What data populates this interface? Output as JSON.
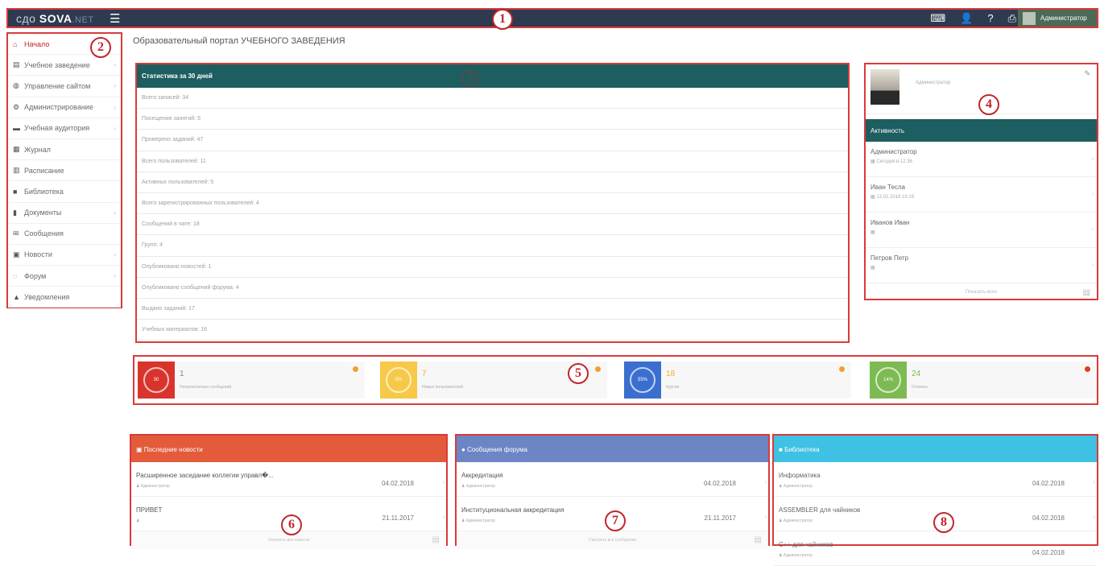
{
  "topbar": {
    "logo_prefix": "сдо",
    "logo_main": "SOVA",
    "logo_suffix": ".NET",
    "menu_icon": "hamburger-icon",
    "icons": [
      "keyboard-icon",
      "user-icon",
      "help-icon",
      "print-icon"
    ],
    "user_name": "Администратор"
  },
  "markers": [
    "1",
    "2",
    "3",
    "4",
    "5",
    "6",
    "7",
    "8"
  ],
  "sidebar": {
    "items": [
      {
        "icon": "home-icon",
        "label": "Начало",
        "active": true,
        "chevron": false
      },
      {
        "icon": "institution-icon",
        "label": "Учебное заведение",
        "active": false,
        "chevron": true
      },
      {
        "icon": "globe-icon",
        "label": "Управление сайтом",
        "active": false,
        "chevron": true
      },
      {
        "icon": "gear-icon",
        "label": "Администрирование",
        "active": false,
        "chevron": true
      },
      {
        "icon": "classroom-icon",
        "label": "Учебная аудитория",
        "active": false,
        "chevron": true
      },
      {
        "icon": "table-icon",
        "label": "Журнал",
        "active": false,
        "chevron": false
      },
      {
        "icon": "schedule-icon",
        "label": "Расписание",
        "active": false,
        "chevron": false
      },
      {
        "icon": "book-icon",
        "label": "Библиотека",
        "active": false,
        "chevron": false
      },
      {
        "icon": "document-icon",
        "label": "Документы",
        "active": false,
        "chevron": true
      },
      {
        "icon": "envelope-icon",
        "label": "Сообщения",
        "active": false,
        "chevron": false
      },
      {
        "icon": "news-icon",
        "label": "Новости",
        "active": false,
        "chevron": true
      },
      {
        "icon": "forum-icon",
        "label": "Форум",
        "active": false,
        "chevron": true
      },
      {
        "icon": "alert-icon",
        "label": "Уведомления",
        "active": false,
        "chevron": false
      }
    ]
  },
  "page_title": "Образовательный портал УЧЕБНОГО ЗАВЕДЕНИЯ",
  "stats_panel": {
    "title": "Статистика за 30 дней",
    "rows": [
      "Всего записей: 34",
      "Посещения занятий: 5",
      "Проверено заданий: 47",
      "Всего пользователей: 11",
      "Активных пользователей: 5",
      "Всего зарегистрированных пользователей: 4",
      "Сообщений в чате: 18",
      "Групп: 4",
      "Опубликовано новостей: 1",
      "Опубликовано сообщений форума: 4",
      "Выдано заданий: 17",
      "Учебных материалов: 16"
    ]
  },
  "profile": {
    "photo_icon": "user-photo",
    "name": "Администратор",
    "edit_icon": "edit-icon",
    "activity_title": "Активность",
    "activity": [
      {
        "name": "Администратор",
        "date": "Сегодня в 12:36"
      },
      {
        "name": "Иван Тесла",
        "date": "13.02.2018 10:19"
      },
      {
        "name": "Иванов Иван",
        "date": ""
      },
      {
        "name": "Петров Петр",
        "date": ""
      }
    ],
    "more_label": "Показать всех",
    "calendar_icon": "calendar-icon"
  },
  "info_boxes": [
    {
      "ring": "30",
      "number": "1",
      "label": "Непрочитанных сообщений",
      "color": "#d9342c",
      "num_color": "#888",
      "dot": "#f0a030"
    },
    {
      "ring": "0%",
      "number": "7",
      "label": "Новых пользователей",
      "color": "#f7c948",
      "num_color": "#f0b030",
      "dot": "#f0a030"
    },
    {
      "ring": "55%",
      "number": "18",
      "label": "Курсов",
      "color": "#3a6fd0",
      "num_color": "#f0b030",
      "dot": "#f0a030"
    },
    {
      "ring": "14%",
      "number": "24",
      "label": "Отлично",
      "color": "#7dbb52",
      "num_color": "#7dbb52",
      "dot": "#d94020"
    }
  ],
  "widgets": {
    "news": {
      "title": "Последние новости",
      "icon": "news-icon",
      "color": "#e35b3b",
      "items": [
        {
          "title": "Расширенное заседание коллегии управл�...",
          "author": "Администратор",
          "date": "04.02.2018"
        },
        {
          "title": "ПРИВЕТ",
          "author": "",
          "date": "21.11.2017"
        }
      ],
      "footer": "Смотреть все новости"
    },
    "forum": {
      "title": "Сообщения форума",
      "icon": "chat-icon",
      "color": "#6d85c4",
      "items": [
        {
          "title": "Аккредитация",
          "author": "Администратор",
          "date": "04.02.2018"
        },
        {
          "title": "Институциональная аккредитация",
          "author": "Администратор",
          "date": "21.11.2017"
        }
      ],
      "footer": "Смотреть все сообщения"
    },
    "library": {
      "title": "Библиотека",
      "icon": "book-icon",
      "color": "#3fc1e4",
      "items": [
        {
          "title": "Информатика",
          "author": "Администратор",
          "date": "04.02.2018"
        },
        {
          "title": "ASSEMBLER для чайников",
          "author": "Администратор",
          "date": "04.02.2018"
        },
        {
          "title": "C++ для чайников",
          "author": "Администратор",
          "date": "04.02.2018"
        }
      ]
    }
  }
}
